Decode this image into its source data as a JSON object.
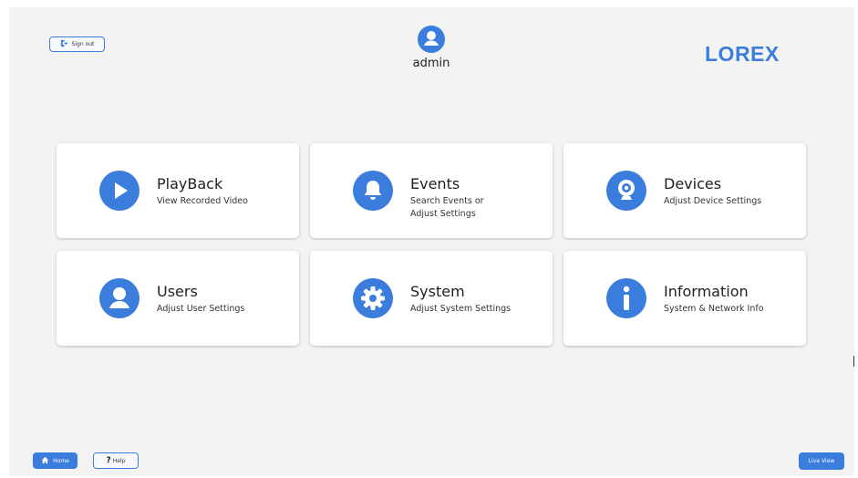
{
  "header": {
    "signout_label": "Sign out",
    "username": "admin",
    "logo_text": "LOREX"
  },
  "tiles": [
    {
      "title": "PlayBack",
      "desc": "View Recorded Video",
      "icon": "play-icon"
    },
    {
      "title": "Events",
      "desc": "Search Events or Adjust Settings",
      "icon": "bell-icon"
    },
    {
      "title": "Devices",
      "desc": "Adjust Device Settings",
      "icon": "camera-icon"
    },
    {
      "title": "Users",
      "desc": "Adjust User Settings",
      "icon": "user-icon"
    },
    {
      "title": "System",
      "desc": "Adjust System Settings",
      "icon": "gear-icon"
    },
    {
      "title": "Information",
      "desc": "System & Network Info",
      "icon": "info-icon"
    }
  ],
  "footer": {
    "home_label": "Home",
    "help_label": "Help",
    "help_glyph": "?",
    "live_view_label": "Live View"
  },
  "colors": {
    "accent": "#3b7ddd",
    "background": "#f3f3f3",
    "tile": "#ffffff"
  }
}
